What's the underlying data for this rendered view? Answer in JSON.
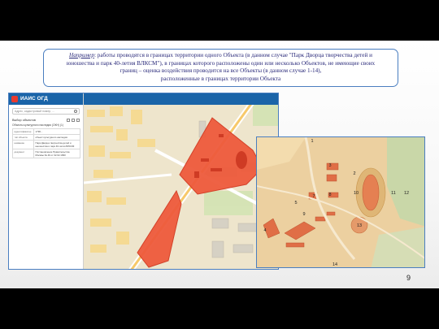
{
  "callout": {
    "lead": "Например",
    "text_1": ": работы проводятся в границах территории одного Объекта (в данном случае \"Парк Дворца творчества детей и",
    "text_2": "юношества и парк 40-летия ВЛКСМ\"), в границах которого расположены один или несколько Объектов, не имеющие своих",
    "text_3": "границ – оценка воздействия проводится на все Объекты (в данном случае 1-14),",
    "text_4": "расположенные в границах территории Объекта"
  },
  "app": {
    "title": "ИАИС ОГД",
    "search_placeholder": "Адрес, кадастровый номер, ...",
    "layer_header": "Выбор объектов",
    "layer_item": "Объекты культурного наследия (ОКН) (1)",
    "attributes": [
      {
        "key": "идентификатор",
        "value": "1796..."
      },
      {
        "key": "тип объекта",
        "value": "объект культурного наследия"
      },
      {
        "key": "название",
        "value": "Парк Дворца творчества детей и юношества и парк 40-летия ВЛКСМ"
      },
      {
        "key": "документ",
        "value": "Постановление Правительства Москвы № 49 от 02.02.1990"
      }
    ]
  },
  "detail_labels": [
    "1",
    "2",
    "3",
    "4",
    "5",
    "7",
    "8",
    "9",
    "10",
    "11",
    "12",
    "13",
    "14"
  ],
  "page_number": "9",
  "colors": {
    "object_fill": "#ee5a3c",
    "callout_border": "#4a7ec0",
    "header_blue": "#1a64a8"
  }
}
